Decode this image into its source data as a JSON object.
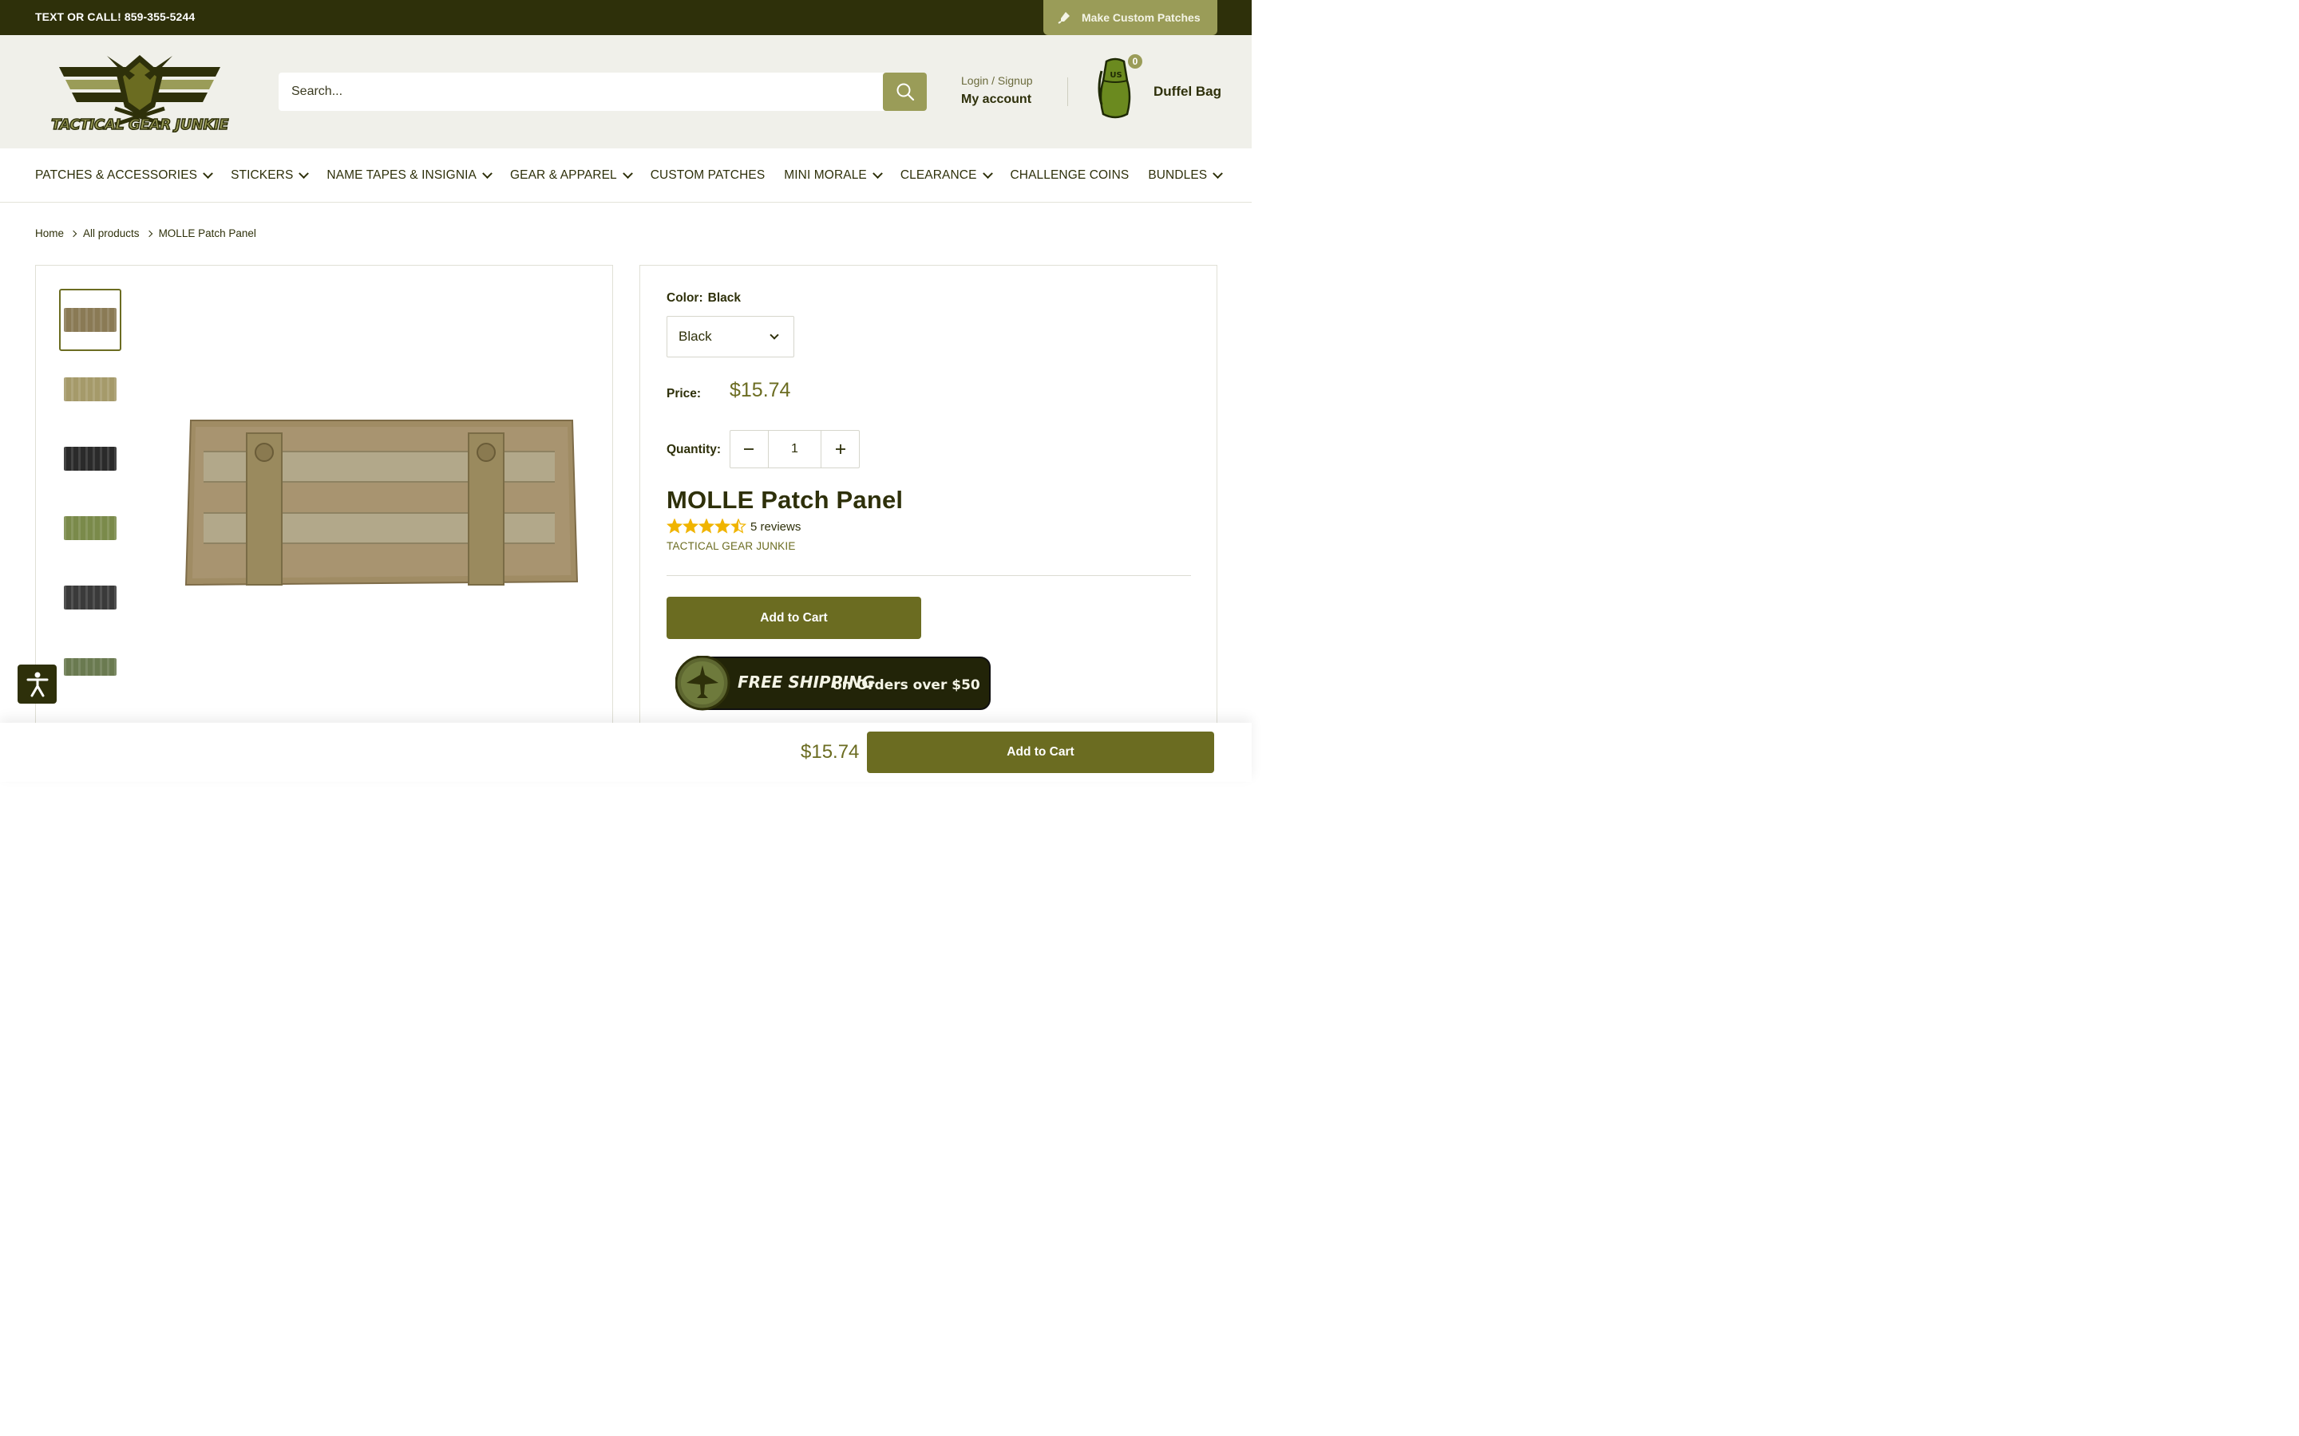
{
  "announcement": {
    "phone_text": "TEXT OR CALL! 859-355-5244",
    "custom_patches_label": "Make Custom Patches"
  },
  "header": {
    "logo_text": "TACTICAL GEAR JUNKIE",
    "search_placeholder": "Search...",
    "login_label": "Login / Signup",
    "account_label": "My account",
    "cart_count": "0",
    "cart_label": "Duffel Bag",
    "bag_marking": "US"
  },
  "nav": {
    "items": [
      {
        "label": "PATCHES & ACCESSORIES",
        "dropdown": true
      },
      {
        "label": "STICKERS",
        "dropdown": true
      },
      {
        "label": "NAME TAPES & INSIGNIA",
        "dropdown": true
      },
      {
        "label": "GEAR & APPAREL",
        "dropdown": true
      },
      {
        "label": "CUSTOM PATCHES",
        "dropdown": false
      },
      {
        "label": "MINI MORALE",
        "dropdown": true
      },
      {
        "label": "CLEARANCE",
        "dropdown": true
      },
      {
        "label": "CHALLENGE COINS",
        "dropdown": false
      },
      {
        "label": "BUNDLES",
        "dropdown": true
      }
    ]
  },
  "breadcrumb": {
    "items": [
      "Home",
      "All products",
      "MOLLE Patch Panel"
    ]
  },
  "gallery": {
    "thumbnails": [
      {
        "name": "thumb-coyote-front",
        "color": "#8a7a55",
        "active": true
      },
      {
        "name": "thumb-tan-back",
        "color": "#a59a6a",
        "active": false
      },
      {
        "name": "thumb-black",
        "color": "#2a2a2a",
        "active": false
      },
      {
        "name": "thumb-od-green",
        "color": "#7a8a4a",
        "active": false
      },
      {
        "name": "thumb-black-front",
        "color": "#3a3a3a",
        "active": false
      },
      {
        "name": "thumb-camo",
        "color": "#6a7a50",
        "active": false
      }
    ]
  },
  "product": {
    "color_label": "Color:",
    "color_value": "Black",
    "selected_option": "Black",
    "price_label": "Price:",
    "price": "$15.74",
    "quantity_label": "Quantity:",
    "quantity": "1",
    "title": "MOLLE Patch Panel",
    "rating": 4.5,
    "reviews_text": "5 reviews",
    "vendor": "TACTICAL GEAR JUNKIE",
    "add_to_cart": "Add to Cart",
    "shipping_banner_bold": "FREE SHIPPING",
    "shipping_banner_text": "on Orders over $50"
  },
  "sticky_bar": {
    "price": "$15.74",
    "add_to_cart": "Add to Cart"
  },
  "colors": {
    "dark_olive": "#2e300a",
    "accent_olive": "#6b6c21",
    "light_olive": "#9a9c58",
    "header_bg": "#f0f0ea",
    "star": "#f0b400"
  }
}
